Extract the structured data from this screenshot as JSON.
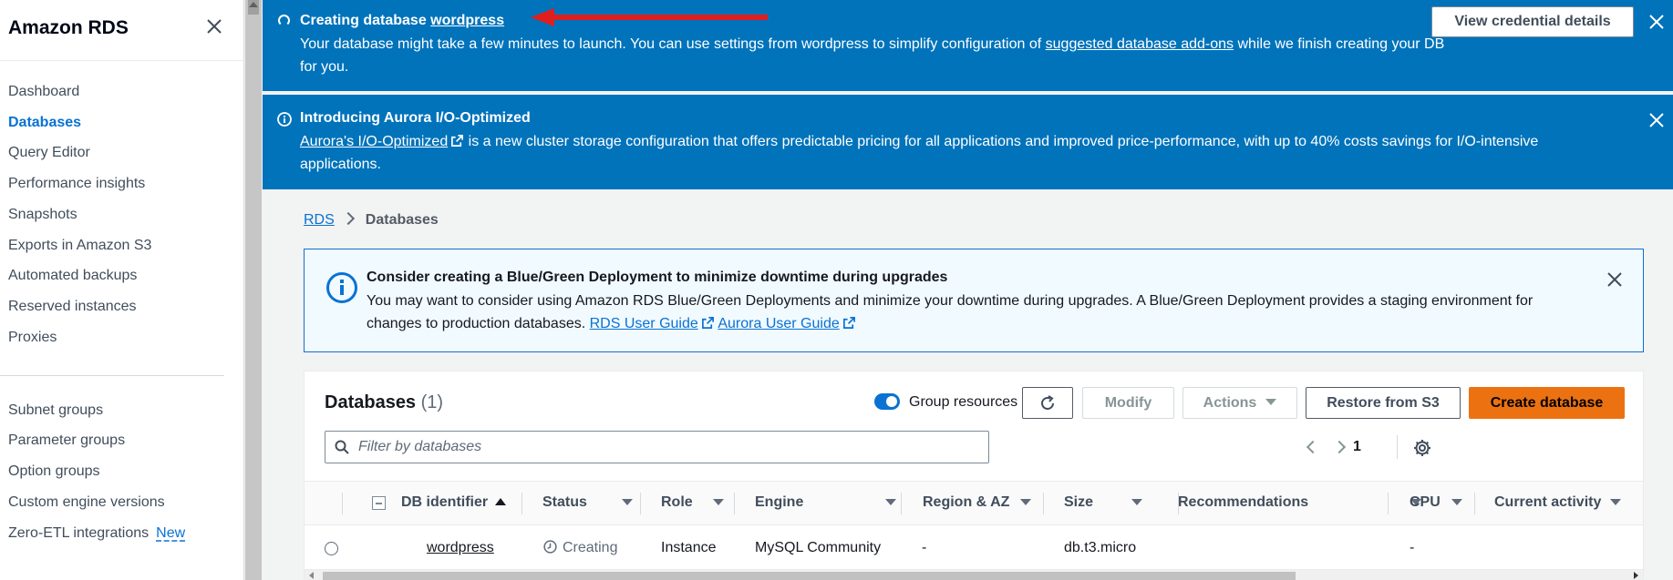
{
  "sidebar": {
    "title": "Amazon RDS",
    "items": [
      {
        "label": "Dashboard",
        "active": false
      },
      {
        "label": "Databases",
        "active": true
      },
      {
        "label": "Query Editor",
        "active": false
      },
      {
        "label": "Performance insights",
        "active": false
      },
      {
        "label": "Snapshots",
        "active": false
      },
      {
        "label": "Exports in Amazon S3",
        "active": false
      },
      {
        "label": "Automated backups",
        "active": false
      },
      {
        "label": "Reserved instances",
        "active": false
      },
      {
        "label": "Proxies",
        "active": false
      }
    ],
    "items2": [
      {
        "label": "Subnet groups"
      },
      {
        "label": "Parameter groups"
      },
      {
        "label": "Option groups"
      },
      {
        "label": "Custom engine versions"
      },
      {
        "label": "Zero-ETL integrations",
        "badge": "New"
      }
    ]
  },
  "flash_creating": {
    "title_prefix": "Creating database",
    "db_name": "wordpress",
    "body_1": "Your database might take a few minutes to launch. You can use settings from wordpress to simplify configuration of",
    "body_link": "suggested database add-ons",
    "body_2": "while we finish creating your DB for you.",
    "button": "View credential details"
  },
  "flash_aurora": {
    "title": "Introducing Aurora I/O-Optimized",
    "link": "Aurora's I/O-Optimized",
    "body": "is a new cluster storage configuration that offers predictable pricing for all applications and improved price-performance, with up to 40% costs savings for I/O-intensive applications."
  },
  "breadcrumb": {
    "root": "RDS",
    "current": "Databases"
  },
  "bg_alert": {
    "title": "Consider creating a Blue/Green Deployment to minimize downtime during upgrades",
    "body": "You may want to consider using Amazon RDS Blue/Green Deployments and minimize your downtime during upgrades. A Blue/Green Deployment provides a staging environment for changes to production databases.",
    "link1": "RDS User Guide",
    "link2": "Aurora User Guide"
  },
  "panel": {
    "title": "Databases",
    "count": "(1)",
    "toggle_label": "Group resources",
    "btn_modify": "Modify",
    "btn_actions": "Actions",
    "btn_restore": "Restore from S3",
    "btn_create": "Create database",
    "search_placeholder": "Filter by databases",
    "page": "1"
  },
  "table": {
    "headers": [
      "DB identifier",
      "Status",
      "Role",
      "Engine",
      "Region & AZ",
      "Size",
      "Recommendations",
      "CPU",
      "Current activity"
    ],
    "row": {
      "identifier": "wordpress",
      "status": "Creating",
      "role": "Instance",
      "engine": "MySQL Community",
      "region": "-",
      "size": "db.t3.micro",
      "recommendations": "",
      "cpu": "-"
    }
  },
  "colors": {
    "accent": "#0972d3",
    "flash": "#0073bb",
    "primary_button": "#ec7211",
    "annotation": "#e01e1e"
  }
}
